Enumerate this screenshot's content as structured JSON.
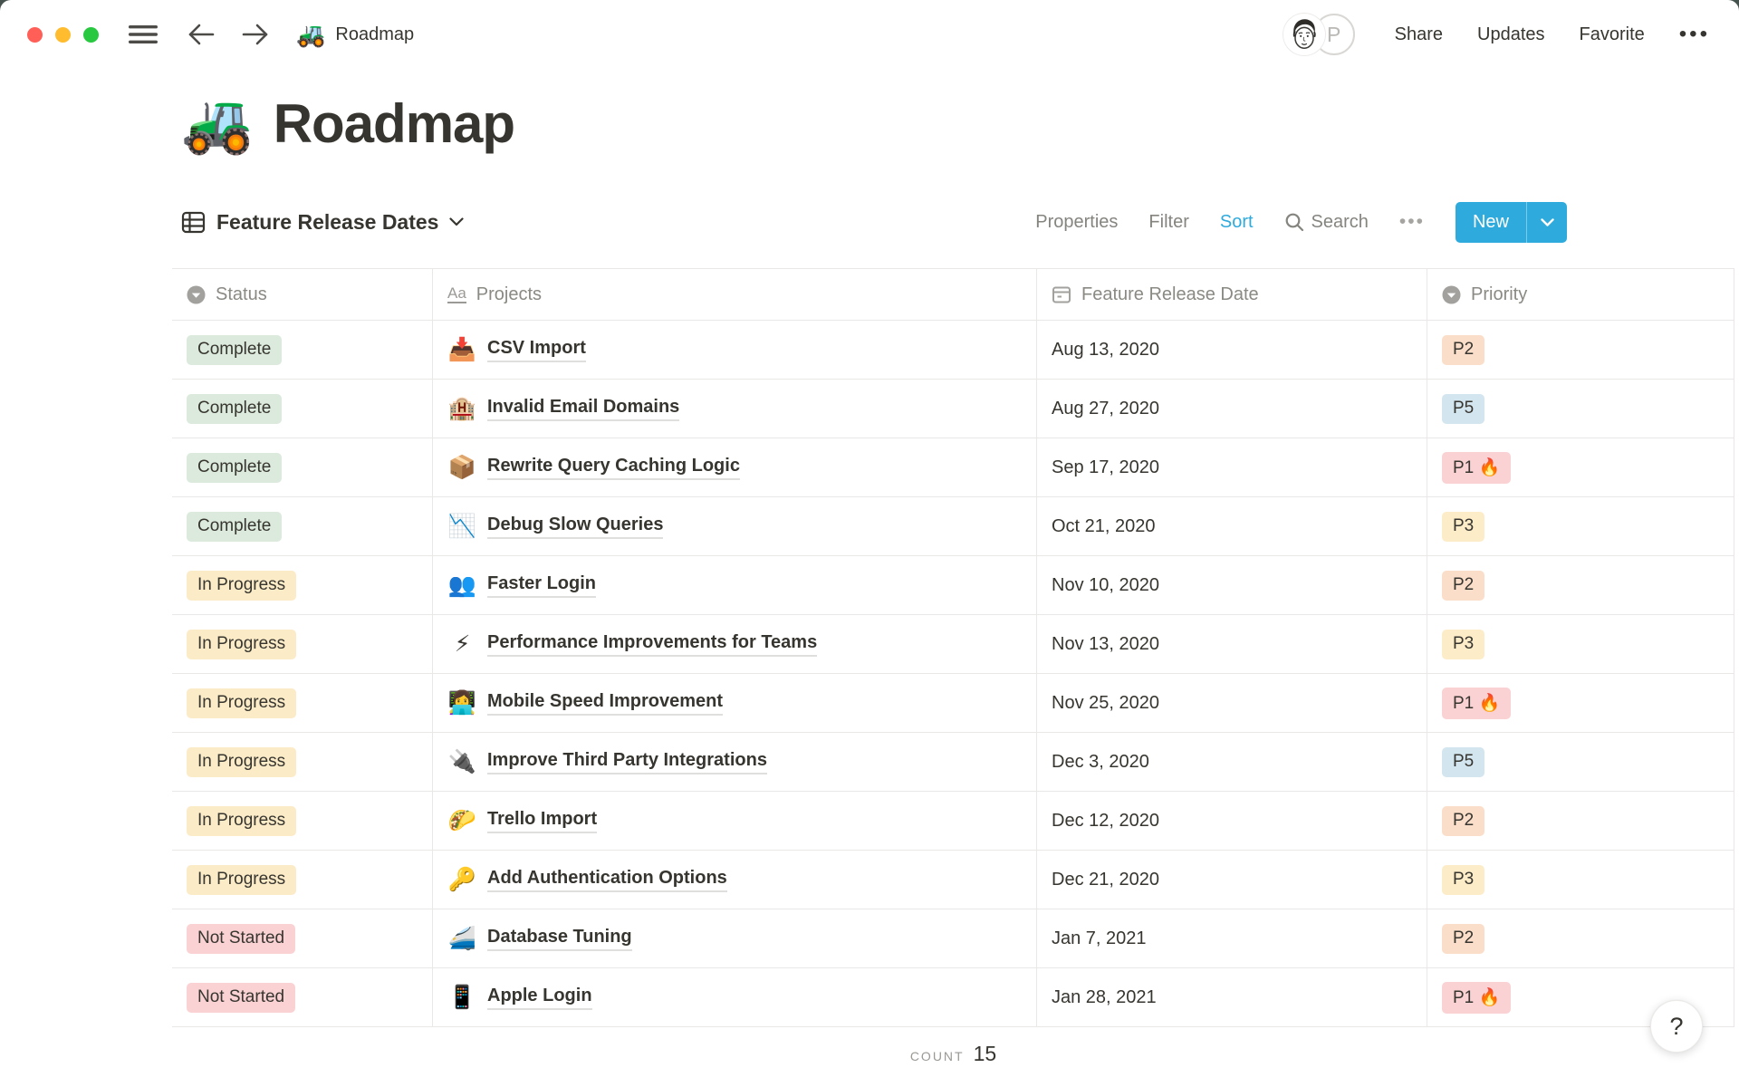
{
  "topbar": {
    "traffic_lights": {
      "close": "#FF5F57",
      "minimize": "#FEBC2E",
      "zoom": "#28C840"
    },
    "doc_emoji": "🚜",
    "doc_title": "Roadmap",
    "avatar_initial": "P",
    "share_label": "Share",
    "updates_label": "Updates",
    "favorite_label": "Favorite",
    "more_label": "•••"
  },
  "page": {
    "emoji": "🚜",
    "title": "Roadmap"
  },
  "view_bar": {
    "view_name": "Feature Release Dates",
    "properties_label": "Properties",
    "filter_label": "Filter",
    "sort_label": "Sort",
    "search_label": "Search",
    "more_label": "•••",
    "new_label": "New",
    "accent_blue": "#2EAADC"
  },
  "table": {
    "columns": [
      {
        "label": "Status",
        "icon": "select-icon"
      },
      {
        "label": "Projects",
        "icon": "title-icon",
        "icon_text": "Aa"
      },
      {
        "label": "Feature Release Date",
        "icon": "calendar-icon"
      },
      {
        "label": "Priority",
        "icon": "select-icon"
      }
    ],
    "status_colors": {
      "Complete": "#DBEADD",
      "In Progress": "#FBEBC7",
      "Not Started": "#FBD2D4"
    },
    "priority_colors": {
      "P2": "#FADEC9",
      "P5": "#D3E5EF",
      "P1 🔥": "#FBD2D4",
      "P3": "#FDECC8"
    },
    "rows": [
      {
        "status": "Complete",
        "emoji": "📥",
        "project": "CSV Import",
        "date": "Aug 13, 2020",
        "priority": "P2"
      },
      {
        "status": "Complete",
        "emoji": "🏨",
        "project": "Invalid Email Domains",
        "date": "Aug 27, 2020",
        "priority": "P5"
      },
      {
        "status": "Complete",
        "emoji": "📦",
        "project": "Rewrite Query Caching Logic",
        "date": "Sep 17, 2020",
        "priority": "P1 🔥"
      },
      {
        "status": "Complete",
        "emoji": "📉",
        "project": "Debug Slow Queries",
        "date": "Oct 21, 2020",
        "priority": "P3"
      },
      {
        "status": "In Progress",
        "emoji": "👥",
        "project": "Faster Login",
        "date": "Nov 10, 2020",
        "priority": "P2"
      },
      {
        "status": "In Progress",
        "emoji": "⚡",
        "project": "Performance Improvements for Teams",
        "date": "Nov 13, 2020",
        "priority": "P3"
      },
      {
        "status": "In Progress",
        "emoji": "👩‍💻",
        "project": "Mobile Speed Improvement",
        "date": "Nov 25, 2020",
        "priority": "P1 🔥"
      },
      {
        "status": "In Progress",
        "emoji": "🔌",
        "project": "Improve Third Party Integrations",
        "date": "Dec 3, 2020",
        "priority": "P5"
      },
      {
        "status": "In Progress",
        "emoji": "🌮",
        "project": "Trello Import",
        "date": "Dec 12, 2020",
        "priority": "P2"
      },
      {
        "status": "In Progress",
        "emoji": "🔑",
        "project": "Add Authentication Options",
        "date": "Dec 21, 2020",
        "priority": "P3"
      },
      {
        "status": "Not Started",
        "emoji": "🚄",
        "project": "Database Tuning",
        "date": "Jan 7, 2021",
        "priority": "P2"
      },
      {
        "status": "Not Started",
        "emoji": "📱",
        "project": "Apple Login",
        "date": "Jan 28, 2021",
        "priority": "P1 🔥"
      }
    ],
    "footer": {
      "count_label": "COUNT",
      "count_value": "15"
    }
  },
  "help": {
    "label": "?"
  }
}
